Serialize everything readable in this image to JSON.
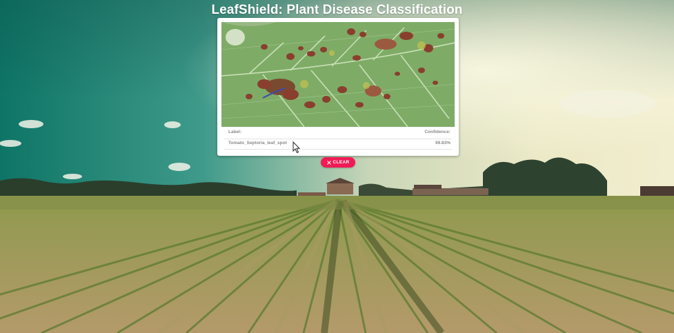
{
  "app": {
    "title": "LeafShield: Plant Disease Classification"
  },
  "result_table": {
    "header_label": "Label:",
    "header_confidence": "Confidence:",
    "rows": [
      {
        "label": "Tomato_Septoria_leaf_spot",
        "confidence": "99.83%"
      }
    ]
  },
  "clear_button": {
    "label": "CLEAR",
    "icon": "close-icon"
  },
  "uploaded_image": {
    "subject": "leaf-image"
  },
  "colors": {
    "accent": "#f01a56",
    "card_bg": "#ffffff",
    "text_muted": "#8a8a8a",
    "title": "#ffffff"
  }
}
